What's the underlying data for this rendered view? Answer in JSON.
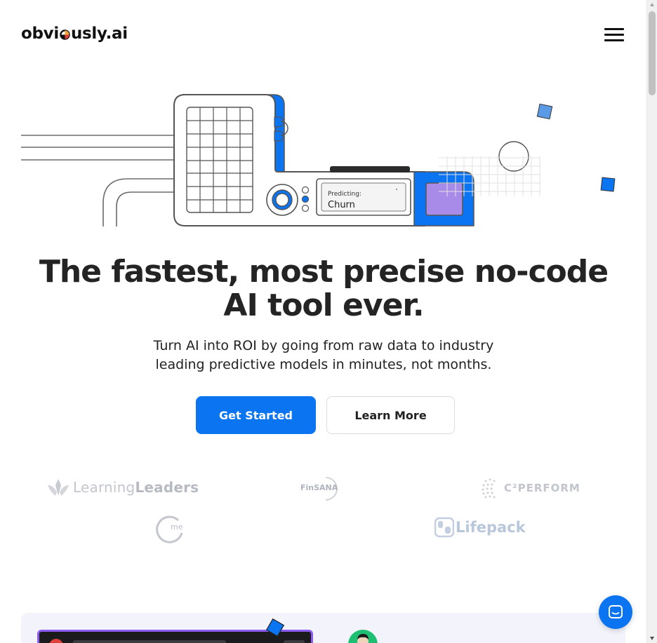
{
  "header": {
    "logo_prefix": "obvi",
    "logo_suffix": "usly.ai",
    "menu_icon": "hamburger-menu-icon"
  },
  "hero": {
    "predicting_label": "Predicting:",
    "predicting_value": "Churn",
    "headline": "The fastest, most precise no-code AI tool ever.",
    "subhead": "Turn AI into ROI by going from raw data to industry leading predictive models in minutes, not months."
  },
  "buttons": {
    "primary": "Get Started",
    "secondary": "Learn More"
  },
  "clients": {
    "learning_leaders_light": "Learning",
    "learning_leaders_bold": "Leaders",
    "finsana": "FinSANA",
    "c2perform": "C²PERFORM",
    "me": "me",
    "lifepack": "Lifepack"
  },
  "colors": {
    "brand_blue": "#0b74f0",
    "accent_purple": "#a88be8",
    "video_border": "#8c5cf0",
    "avatar_green": "#1fbf73"
  },
  "icons": {
    "chat": "chat-bubble-icon"
  }
}
